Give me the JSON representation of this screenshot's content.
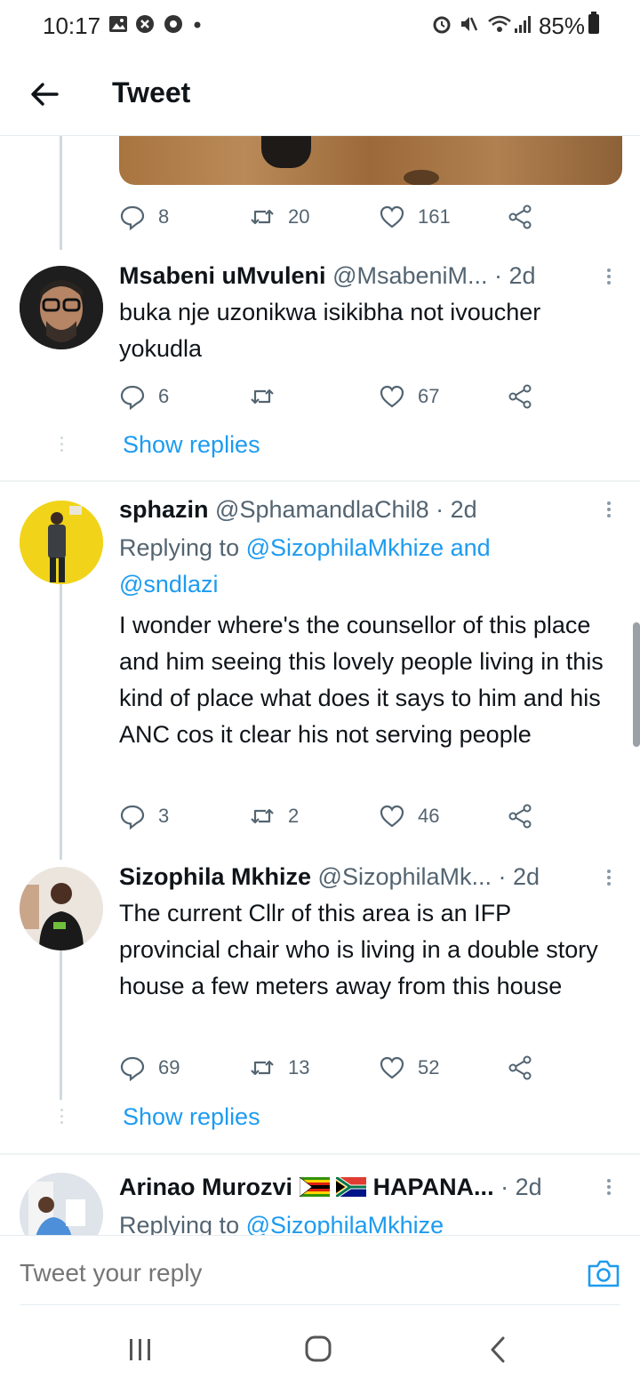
{
  "status_bar": {
    "time": "10:17",
    "battery_pct": "85%",
    "left_icons": [
      "gallery-icon",
      "shield-x-icon",
      "settings-icon",
      "dot-icon"
    ],
    "right_icons": [
      "alarm-icon",
      "mute-icon",
      "wifi-icon",
      "signal-icon",
      "battery-icon"
    ]
  },
  "header": {
    "title": "Tweet"
  },
  "colors": {
    "accent": "#1d9bf0",
    "secondary_text": "#536471",
    "primary_text": "#0f1419"
  },
  "first_tweet_actions": {
    "replies": "8",
    "retweets": "20",
    "likes": "161"
  },
  "tweets": [
    {
      "name": "Msabeni uMvuleni",
      "handle": "@MsabeniM...",
      "time": "· 2d",
      "text": "buka nje uzonikwa isikibha not ivoucher yokudla",
      "replies": "6",
      "retweets": "",
      "likes": "67",
      "show_replies": "Show replies"
    },
    {
      "name": "sphazin",
      "handle": "@SphamandlaChil8",
      "time": "· 2d",
      "replying_prefix": "Replying to",
      "replying_to": "@SizophilaMkhize and @sndlazi",
      "text": "I wonder where's the counsellor of this place and him seeing this lovely people living in this kind of place what does it says to him and his ANC cos it clear his not serving people",
      "replies": "3",
      "retweets": "2",
      "likes": "46"
    },
    {
      "name": "Sizophila Mkhize",
      "handle": "@SizophilaMk...",
      "time": "· 2d",
      "text": "The current Cllr of this area is an IFP provincial chair who is living in a double story house a few meters away from this house",
      "replies": "69",
      "retweets": "13",
      "likes": "52",
      "show_replies": "Show replies"
    },
    {
      "name": "Arinao Murozvi",
      "name_suffix": "HAPANA...",
      "flags": [
        "zimbabwe-flag-icon",
        "south-africa-flag-icon"
      ],
      "time": "· 2d",
      "replying_prefix": "Replying to",
      "replying_to": "@SizophilaMkhize"
    }
  ],
  "reply_bar": {
    "placeholder": "Tweet your reply"
  },
  "nav_bar": {
    "icons": [
      "recents-icon",
      "home-icon",
      "back-icon"
    ]
  }
}
